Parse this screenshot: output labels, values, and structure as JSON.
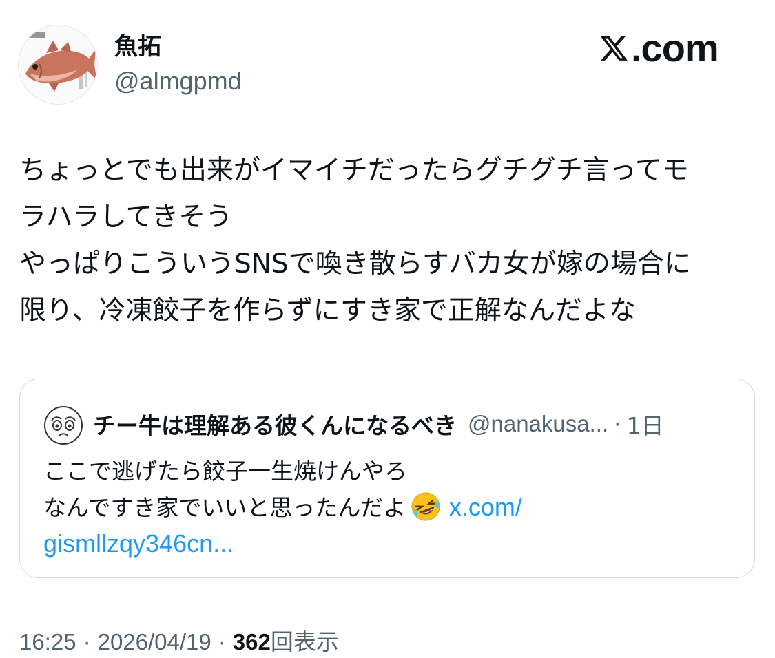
{
  "author": {
    "display_name": "魚拓",
    "handle": "@almgpmd",
    "avatar_icon": "fish-tai-avatar-icon"
  },
  "brand": {
    "logo_icon": "x-logo-icon",
    "text": ".com"
  },
  "tweet": {
    "lines": [
      "ちょっとでも出来がイマイチだったらグチグチ言ってモ",
      "ラハラしてきそう",
      "やっぱりこういうSNSで喚き散らすバカ女が嫁の場合に",
      "限り、冷凍餃子を作らずにすき家で正解なんだよな"
    ]
  },
  "quote": {
    "avatar_icon": "worried-face-avatar-icon",
    "display_name": "チー牛は理解ある彼くんになるべき",
    "handle": "@nanakusa...",
    "separator": "·",
    "time": "1日",
    "body_line1": "ここで逃げたら餃子一生焼けんやろ",
    "body_line2": "なんですき家でいいと思ったんだよ",
    "emoji": "rolling-on-floor-laughing-emoji",
    "link_part1": "x.com/",
    "link_part2": "gismllzqy346cn..."
  },
  "meta": {
    "time": "16:25",
    "separator": "·",
    "date": "2026/04/19",
    "views_count": "362",
    "views_label": "回表示"
  },
  "colors": {
    "text": "#0f1419",
    "secondary": "#536471",
    "link": "#1d9bf0",
    "border": "#cfd9de"
  }
}
